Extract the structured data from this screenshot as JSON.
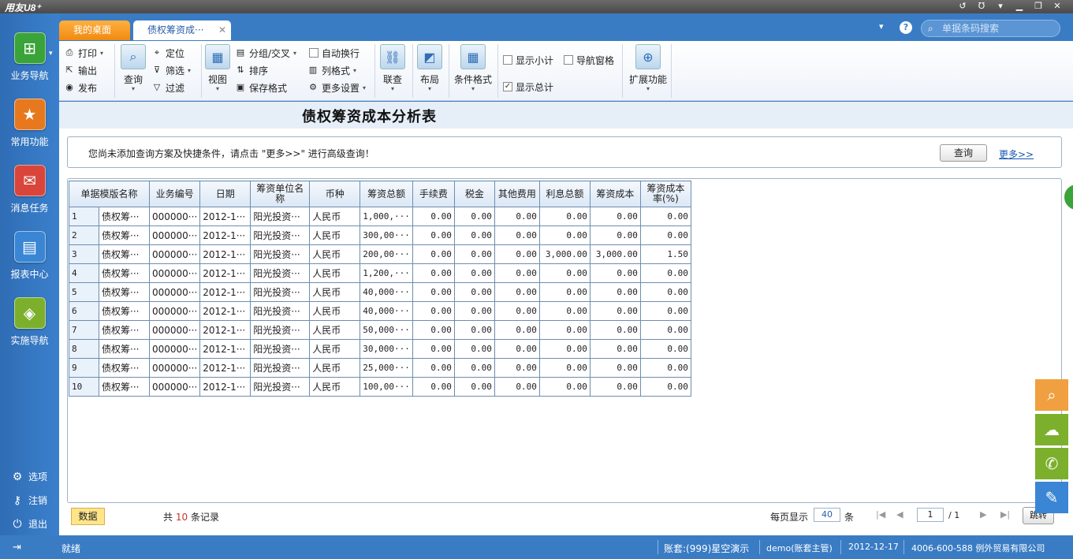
{
  "app": {
    "logo": "用友U8⁺",
    "window_buttons": [
      "↺",
      "Ʊ",
      "▾",
      "▁",
      "❐",
      "✕"
    ]
  },
  "sidebar": {
    "items": [
      {
        "label": "业务导航",
        "icon": "sitemap-icon",
        "color": "#3aa33a",
        "glyph": "⊞"
      },
      {
        "label": "常用功能",
        "icon": "star-icon",
        "color": "#e8781e",
        "glyph": "★"
      },
      {
        "label": "消息任务",
        "icon": "message-icon",
        "color": "#d9453b",
        "glyph": "✉"
      },
      {
        "label": "报表中心",
        "icon": "report-icon",
        "color": "#3a86d4",
        "glyph": "▤"
      },
      {
        "label": "实施导航",
        "icon": "compass-icon",
        "color": "#7cb02c",
        "glyph": "◈"
      }
    ],
    "bottom": [
      {
        "label": "选项",
        "glyph": "⚙"
      },
      {
        "label": "注销",
        "glyph": "⚷"
      },
      {
        "label": "退出",
        "glyph": "⏻"
      }
    ],
    "collapse_glyph": "⇥"
  },
  "tabs": {
    "home": "我的桌面",
    "active": "债权筹资成···",
    "close": "✕",
    "help_caret": "▾",
    "help": "?",
    "search_placeholder": "单据条码搜索",
    "search_glyph": "⌕"
  },
  "toolbar": {
    "print": "打印",
    "export": "输出",
    "publish": "发布",
    "query": "查询",
    "locate": "定位",
    "filter": "筛选",
    "sift": "过滤",
    "view": "视图",
    "group": "分组/交叉",
    "sort": "排序",
    "save_format": "保存格式",
    "auto_wrap": "自动换行",
    "col_format": "列格式",
    "more_settings": "更多设置",
    "link": "联查",
    "layout": "布局",
    "cond_format": "条件格式",
    "show_subtotal": "显示小计",
    "nav_pane": "导航窗格",
    "show_total": "显示总计",
    "extend": "扩展功能",
    "show_subtotal_checked": false,
    "nav_pane_checked": false,
    "show_total_checked": true
  },
  "report": {
    "title": "债权筹资成本分析表",
    "query_msg": "您尚未添加查询方案及快捷条件，请点击 \"更多>>\" 进行高级查询！",
    "query_btn": "查询",
    "more_link": "更多>>"
  },
  "table": {
    "headers": [
      "单据模版名称",
      "业务编号",
      "日期",
      "筹资单位名称",
      "币种",
      "筹资总额",
      "手续费",
      "税金",
      "其他费用",
      "利息总额",
      "筹资成本",
      "筹资成本率(%)"
    ],
    "rows": [
      {
        "n": "1",
        "cells": [
          "债权筹···",
          "000000···",
          "2012-1···",
          "阳光投资···",
          "人民币",
          "1,000,···",
          "0.00",
          "0.00",
          "0.00",
          "0.00",
          "0.00",
          "0.00"
        ]
      },
      {
        "n": "2",
        "cells": [
          "债权筹···",
          "000000···",
          "2012-1···",
          "阳光投资···",
          "人民币",
          "300,00···",
          "0.00",
          "0.00",
          "0.00",
          "0.00",
          "0.00",
          "0.00"
        ]
      },
      {
        "n": "3",
        "cells": [
          "债权筹···",
          "000000···",
          "2012-1···",
          "阳光投资···",
          "人民币",
          "200,00···",
          "0.00",
          "0.00",
          "0.00",
          "3,000.00",
          "3,000.00",
          "1.50"
        ]
      },
      {
        "n": "4",
        "cells": [
          "债权筹···",
          "000000···",
          "2012-1···",
          "阳光投资···",
          "人民币",
          "1,200,···",
          "0.00",
          "0.00",
          "0.00",
          "0.00",
          "0.00",
          "0.00"
        ]
      },
      {
        "n": "5",
        "cells": [
          "债权筹···",
          "000000···",
          "2012-1···",
          "阳光投资···",
          "人民币",
          "40,000···",
          "0.00",
          "0.00",
          "0.00",
          "0.00",
          "0.00",
          "0.00"
        ]
      },
      {
        "n": "6",
        "cells": [
          "债权筹···",
          "000000···",
          "2012-1···",
          "阳光投资···",
          "人民币",
          "40,000···",
          "0.00",
          "0.00",
          "0.00",
          "0.00",
          "0.00",
          "0.00"
        ]
      },
      {
        "n": "7",
        "cells": [
          "债权筹···",
          "000000···",
          "2012-1···",
          "阳光投资···",
          "人民币",
          "50,000···",
          "0.00",
          "0.00",
          "0.00",
          "0.00",
          "0.00",
          "0.00"
        ]
      },
      {
        "n": "8",
        "cells": [
          "债权筹···",
          "000000···",
          "2012-1···",
          "阳光投资···",
          "人民币",
          "30,000···",
          "0.00",
          "0.00",
          "0.00",
          "0.00",
          "0.00",
          "0.00"
        ]
      },
      {
        "n": "9",
        "cells": [
          "债权筹···",
          "000000···",
          "2012-1···",
          "阳光投资···",
          "人民币",
          "25,000···",
          "0.00",
          "0.00",
          "0.00",
          "0.00",
          "0.00",
          "0.00"
        ]
      },
      {
        "n": "10",
        "cells": [
          "债权筹···",
          "000000···",
          "2012-1···",
          "阳光投资···",
          "人民币",
          "100,00···",
          "0.00",
          "0.00",
          "0.00",
          "0.00",
          "0.00",
          "0.00"
        ]
      }
    ]
  },
  "footer": {
    "data_tab": "数据",
    "total_prefix": "共",
    "total_count": "10",
    "total_suffix": "条记录",
    "per_page_label": "每页显示",
    "per_page": "40",
    "per_page_unit": "条",
    "page_first": "|◀",
    "page_prev": "◀",
    "page_next": "▶",
    "page_last": "▶|",
    "page_current": "1",
    "page_total": "/ 1",
    "jump": "跳转"
  },
  "fabs": [
    {
      "icon": "search-icon",
      "glyph": "⌕",
      "color": "#f0a040"
    },
    {
      "icon": "cloud-icon",
      "glyph": "☁",
      "color": "#7cb02c"
    },
    {
      "icon": "chat-icon",
      "glyph": "✆",
      "color": "#7cb02c"
    },
    {
      "icon": "feedback-icon",
      "glyph": "✎",
      "color": "#3a86d4"
    }
  ],
  "statusbar": {
    "ready": "就绪",
    "account": "账套:(999)星空演示",
    "user": "demo(账套主管)",
    "date": "2012-12-17",
    "company": "4006-600-588 例外贸易有限公司"
  }
}
